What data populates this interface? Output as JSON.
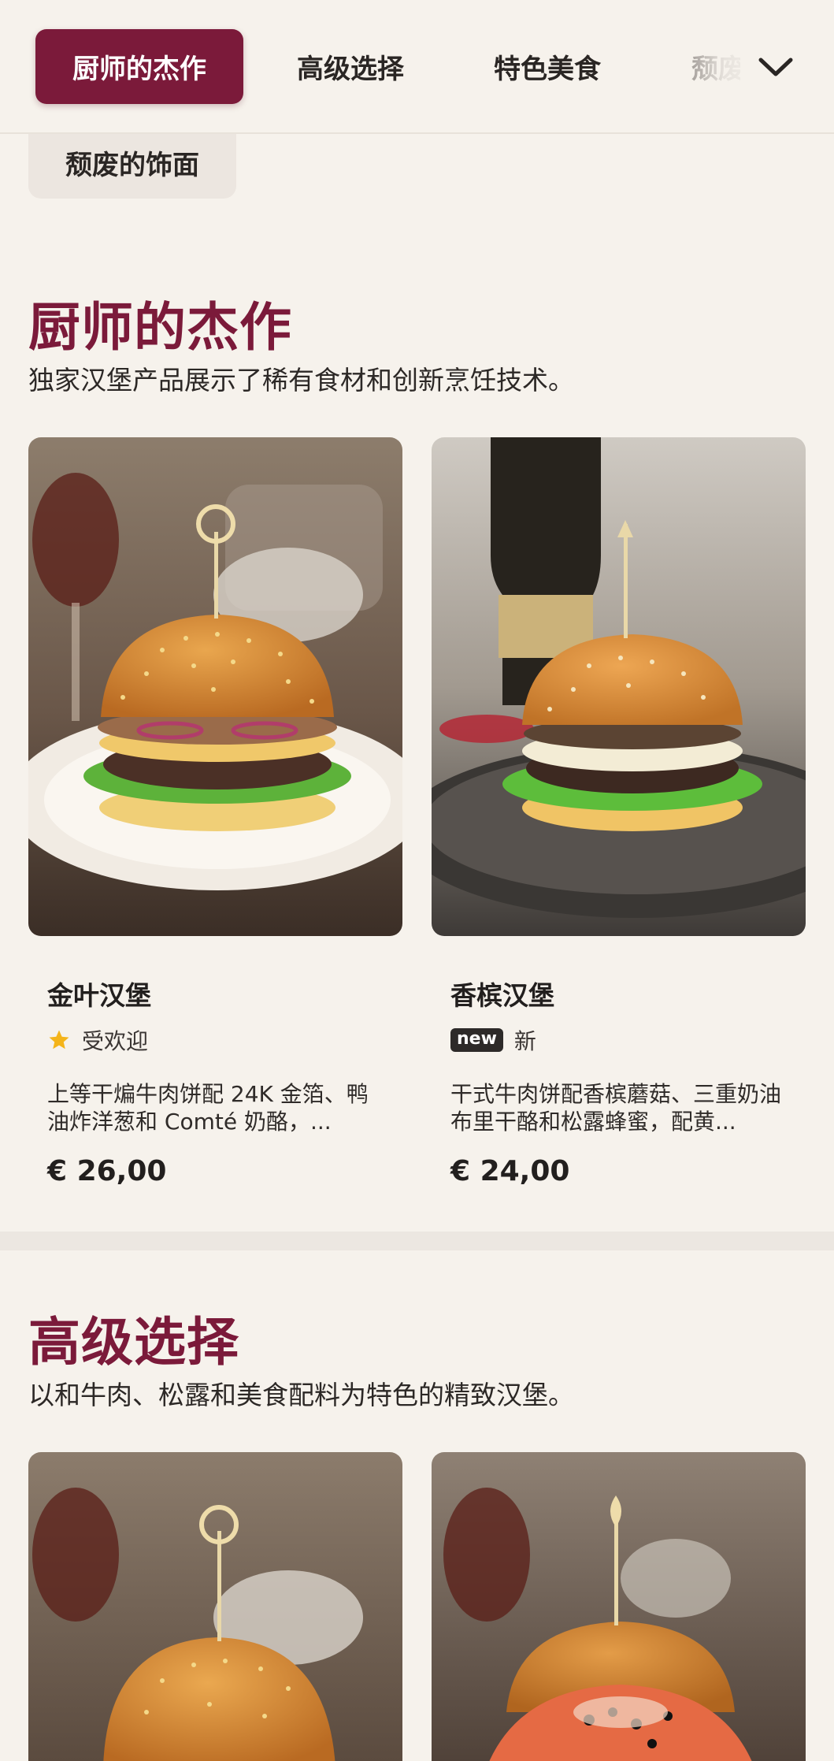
{
  "nav": {
    "tabs": [
      {
        "label": "厨师的杰作",
        "active": true
      },
      {
        "label": "高级选择",
        "active": false
      },
      {
        "label": "特色美食",
        "active": false
      },
      {
        "label": "颓废",
        "active": false
      }
    ],
    "overflow_item": "颓废的饰面",
    "chevron_icon": "chevron-down-icon"
  },
  "sections": [
    {
      "title": "厨师的杰作",
      "description": "独家汉堡产品展示了稀有食材和创新烹饪技术。",
      "items": [
        {
          "name": "金叶汉堡",
          "badge_icon": "star-icon",
          "badge_label": "受欢迎",
          "description": "上等干煸牛肉饼配 24K 金箔、鸭油炸洋葱和 Comté 奶酪，...",
          "price": "€ 26,00"
        },
        {
          "name": "香槟汉堡",
          "badge_pill": "new",
          "badge_label": "新",
          "description": "干式牛肉饼配香槟蘑菇、三重奶油布里干酪和松露蜂蜜，配黄...",
          "price": "€ 24,00"
        }
      ]
    },
    {
      "title": "高级选择",
      "description": "以和牛肉、松露和美食配料为特色的精致汉堡。"
    }
  ],
  "colors": {
    "accent": "#7b1a3a",
    "background": "#f6f2ec",
    "star": "#f4b41a"
  }
}
